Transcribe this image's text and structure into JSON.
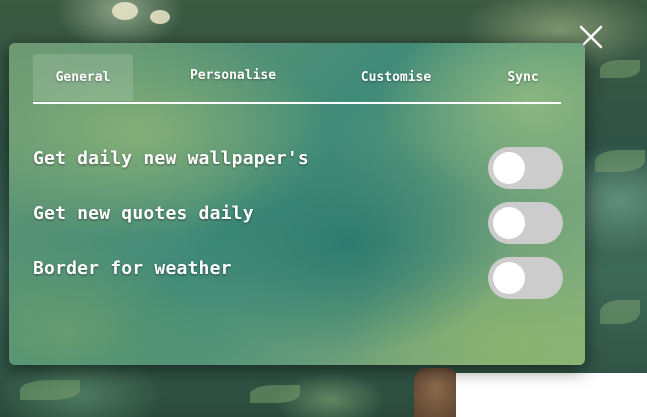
{
  "close": {
    "icon": "close-icon"
  },
  "tabs": [
    {
      "label": "General",
      "active": true
    },
    {
      "label": "Personalise",
      "active": false
    },
    {
      "label": "Customise",
      "active": false
    },
    {
      "label": "Sync",
      "active": false
    }
  ],
  "settings": [
    {
      "label": "Get daily new wallpaper's",
      "enabled": false
    },
    {
      "label": "Get new quotes daily",
      "enabled": false
    },
    {
      "label": "Border for weather",
      "enabled": false
    }
  ],
  "colors": {
    "toggle_off": "#cccccc",
    "toggle_knob": "#ffffff",
    "text": "#ffffff"
  }
}
